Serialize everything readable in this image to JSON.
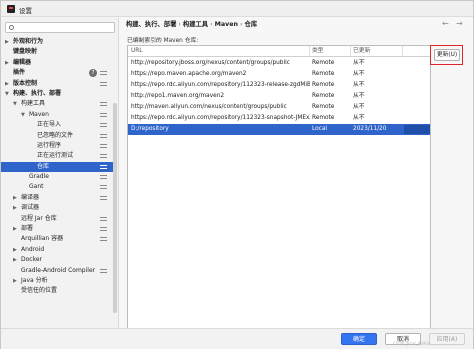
{
  "window": {
    "title": "设置"
  },
  "search": {
    "placeholder": ""
  },
  "sidebar": {
    "items": [
      {
        "label": "外观和行为",
        "indent": 0,
        "arrow": "right",
        "bold": true
      },
      {
        "label": "键盘映射",
        "indent": 0,
        "arrow": "",
        "bold": true
      },
      {
        "label": "编辑器",
        "indent": 0,
        "arrow": "right",
        "bold": true
      },
      {
        "label": "插件",
        "indent": 0,
        "arrow": "",
        "bold": true,
        "badge": "7",
        "proj": true
      },
      {
        "label": "版本控制",
        "indent": 0,
        "arrow": "right",
        "bold": true,
        "proj": true
      },
      {
        "label": "构建、执行、部署",
        "indent": 0,
        "arrow": "down",
        "bold": true
      },
      {
        "label": "构建工具",
        "indent": 1,
        "arrow": "down",
        "bold": false,
        "proj": true
      },
      {
        "label": "Maven",
        "indent": 2,
        "arrow": "down",
        "bold": false,
        "proj": true
      },
      {
        "label": "正在导入",
        "indent": 3,
        "arrow": "",
        "bold": false,
        "proj": true
      },
      {
        "label": "已忽略的文件",
        "indent": 3,
        "arrow": "",
        "bold": false,
        "proj": true
      },
      {
        "label": "运行程序",
        "indent": 3,
        "arrow": "",
        "bold": false,
        "proj": true
      },
      {
        "label": "正在运行测试",
        "indent": 3,
        "arrow": "",
        "bold": false,
        "proj": true
      },
      {
        "label": "仓库",
        "indent": 3,
        "arrow": "",
        "bold": false,
        "proj": true,
        "selected": true
      },
      {
        "label": "Gradle",
        "indent": 2,
        "arrow": "",
        "bold": false,
        "proj": true
      },
      {
        "label": "Gant",
        "indent": 2,
        "arrow": "",
        "bold": false,
        "proj": true
      },
      {
        "label": "编译器",
        "indent": 1,
        "arrow": "right",
        "bold": false,
        "proj": true
      },
      {
        "label": "调试器",
        "indent": 1,
        "arrow": "right",
        "bold": false
      },
      {
        "label": "远程 Jar 仓库",
        "indent": 1,
        "arrow": "",
        "bold": false,
        "proj": true
      },
      {
        "label": "部署",
        "indent": 1,
        "arrow": "right",
        "bold": false,
        "proj": true
      },
      {
        "label": "Arquillian 容器",
        "indent": 1,
        "arrow": "",
        "bold": false,
        "proj": true
      },
      {
        "label": "Android",
        "indent": 1,
        "arrow": "right",
        "bold": false
      },
      {
        "label": "Docker",
        "indent": 1,
        "arrow": "right",
        "bold": false
      },
      {
        "label": "Gradle-Android Compiler",
        "indent": 1,
        "arrow": "",
        "bold": false,
        "proj": true
      },
      {
        "label": "Java 分析",
        "indent": 1,
        "arrow": "right",
        "bold": false
      },
      {
        "label": "受信任的位置",
        "indent": 1,
        "arrow": "",
        "bold": false
      }
    ]
  },
  "breadcrumb": {
    "parts": [
      "构建、执行、部署",
      "构建工具",
      "Maven",
      "仓库"
    ]
  },
  "main": {
    "hint": "已编制索引的 Maven 仓库:",
    "update_button": "更新(U)",
    "table": {
      "headers": [
        "URL",
        "类型",
        "已更新",
        ""
      ],
      "rows": [
        {
          "url": "http://repository.jboss.org/nexus/content/groups/public",
          "type": "Remote",
          "updated": "从不",
          "selected": false
        },
        {
          "url": "https://repo.maven.apache.org/maven2",
          "type": "Remote",
          "updated": "从不",
          "selected": false
        },
        {
          "url": "https://repo.rdc.aliyun.com/repository/112323-release-zgdMiB",
          "type": "Remote",
          "updated": "从不",
          "selected": false
        },
        {
          "url": "http://repo1.maven.org/maven2",
          "type": "Remote",
          "updated": "从不",
          "selected": false
        },
        {
          "url": "http://maven.aliyun.com/nexus/content/groups/public",
          "type": "Remote",
          "updated": "从不",
          "selected": false
        },
        {
          "url": "https://repo.rdc.aliyun.com/repository/112323-snapshot-JMExZf",
          "type": "Remote",
          "updated": "从不",
          "selected": false
        },
        {
          "url": "D:/repository",
          "type": "Local",
          "updated": "2023/11/20",
          "selected": true
        }
      ]
    }
  },
  "footer": {
    "ok": "确定",
    "cancel": "取消",
    "apply": "应用(A)"
  },
  "watermark": "CSDN @cat_KaiKai"
}
